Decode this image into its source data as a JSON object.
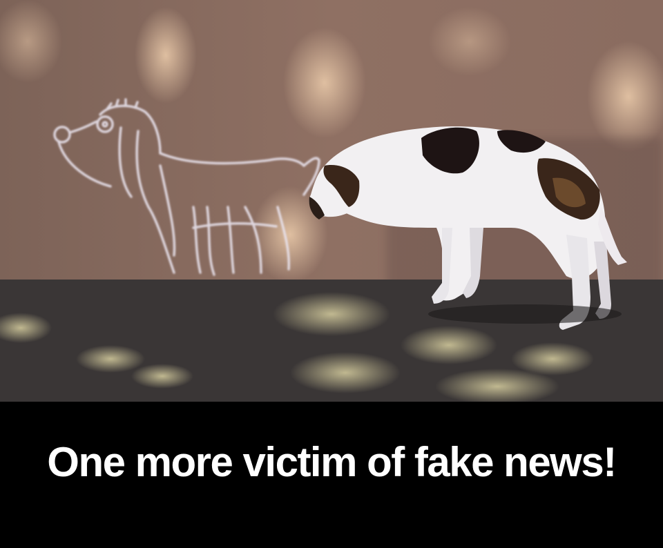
{
  "caption": {
    "text": "One more victim of fake news!"
  },
  "photo": {
    "subjects": [
      "chalk-drawn-dog",
      "real-dog"
    ],
    "colors": {
      "wall": "#8a6a5c",
      "ground": "#3a3636",
      "chalk": "#e8e2ec",
      "dog_white": "#f2f0f2",
      "dog_patch": "#1e1414",
      "dog_brown": "#6b4a2c",
      "caption_bar": "#000000",
      "caption_text": "#ffffff"
    }
  }
}
